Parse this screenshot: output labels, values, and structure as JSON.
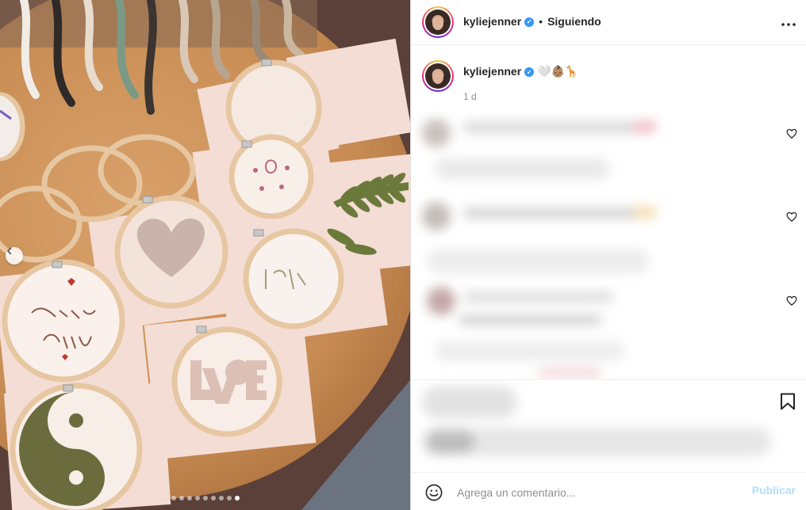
{
  "post": {
    "username": "kyliejenner",
    "follow_status": "Siguiendo",
    "separator": "•",
    "more_icon": "more-options-icon",
    "caption_emojis": "🤍👶🏽🦒",
    "time_ago": "1 d",
    "verified_icon": "verified-badge-icon"
  },
  "carousel": {
    "total_slides": 9,
    "active_slide": 9
  },
  "comment_box": {
    "placeholder": "Agrega un comentario...",
    "publish_label": "Publicar"
  },
  "colors": {
    "text": "#262626",
    "muted": "#8e8e8e",
    "verified": "#3897f0",
    "publish_disabled": "#b2dffc",
    "border": "#dbdbdb"
  }
}
